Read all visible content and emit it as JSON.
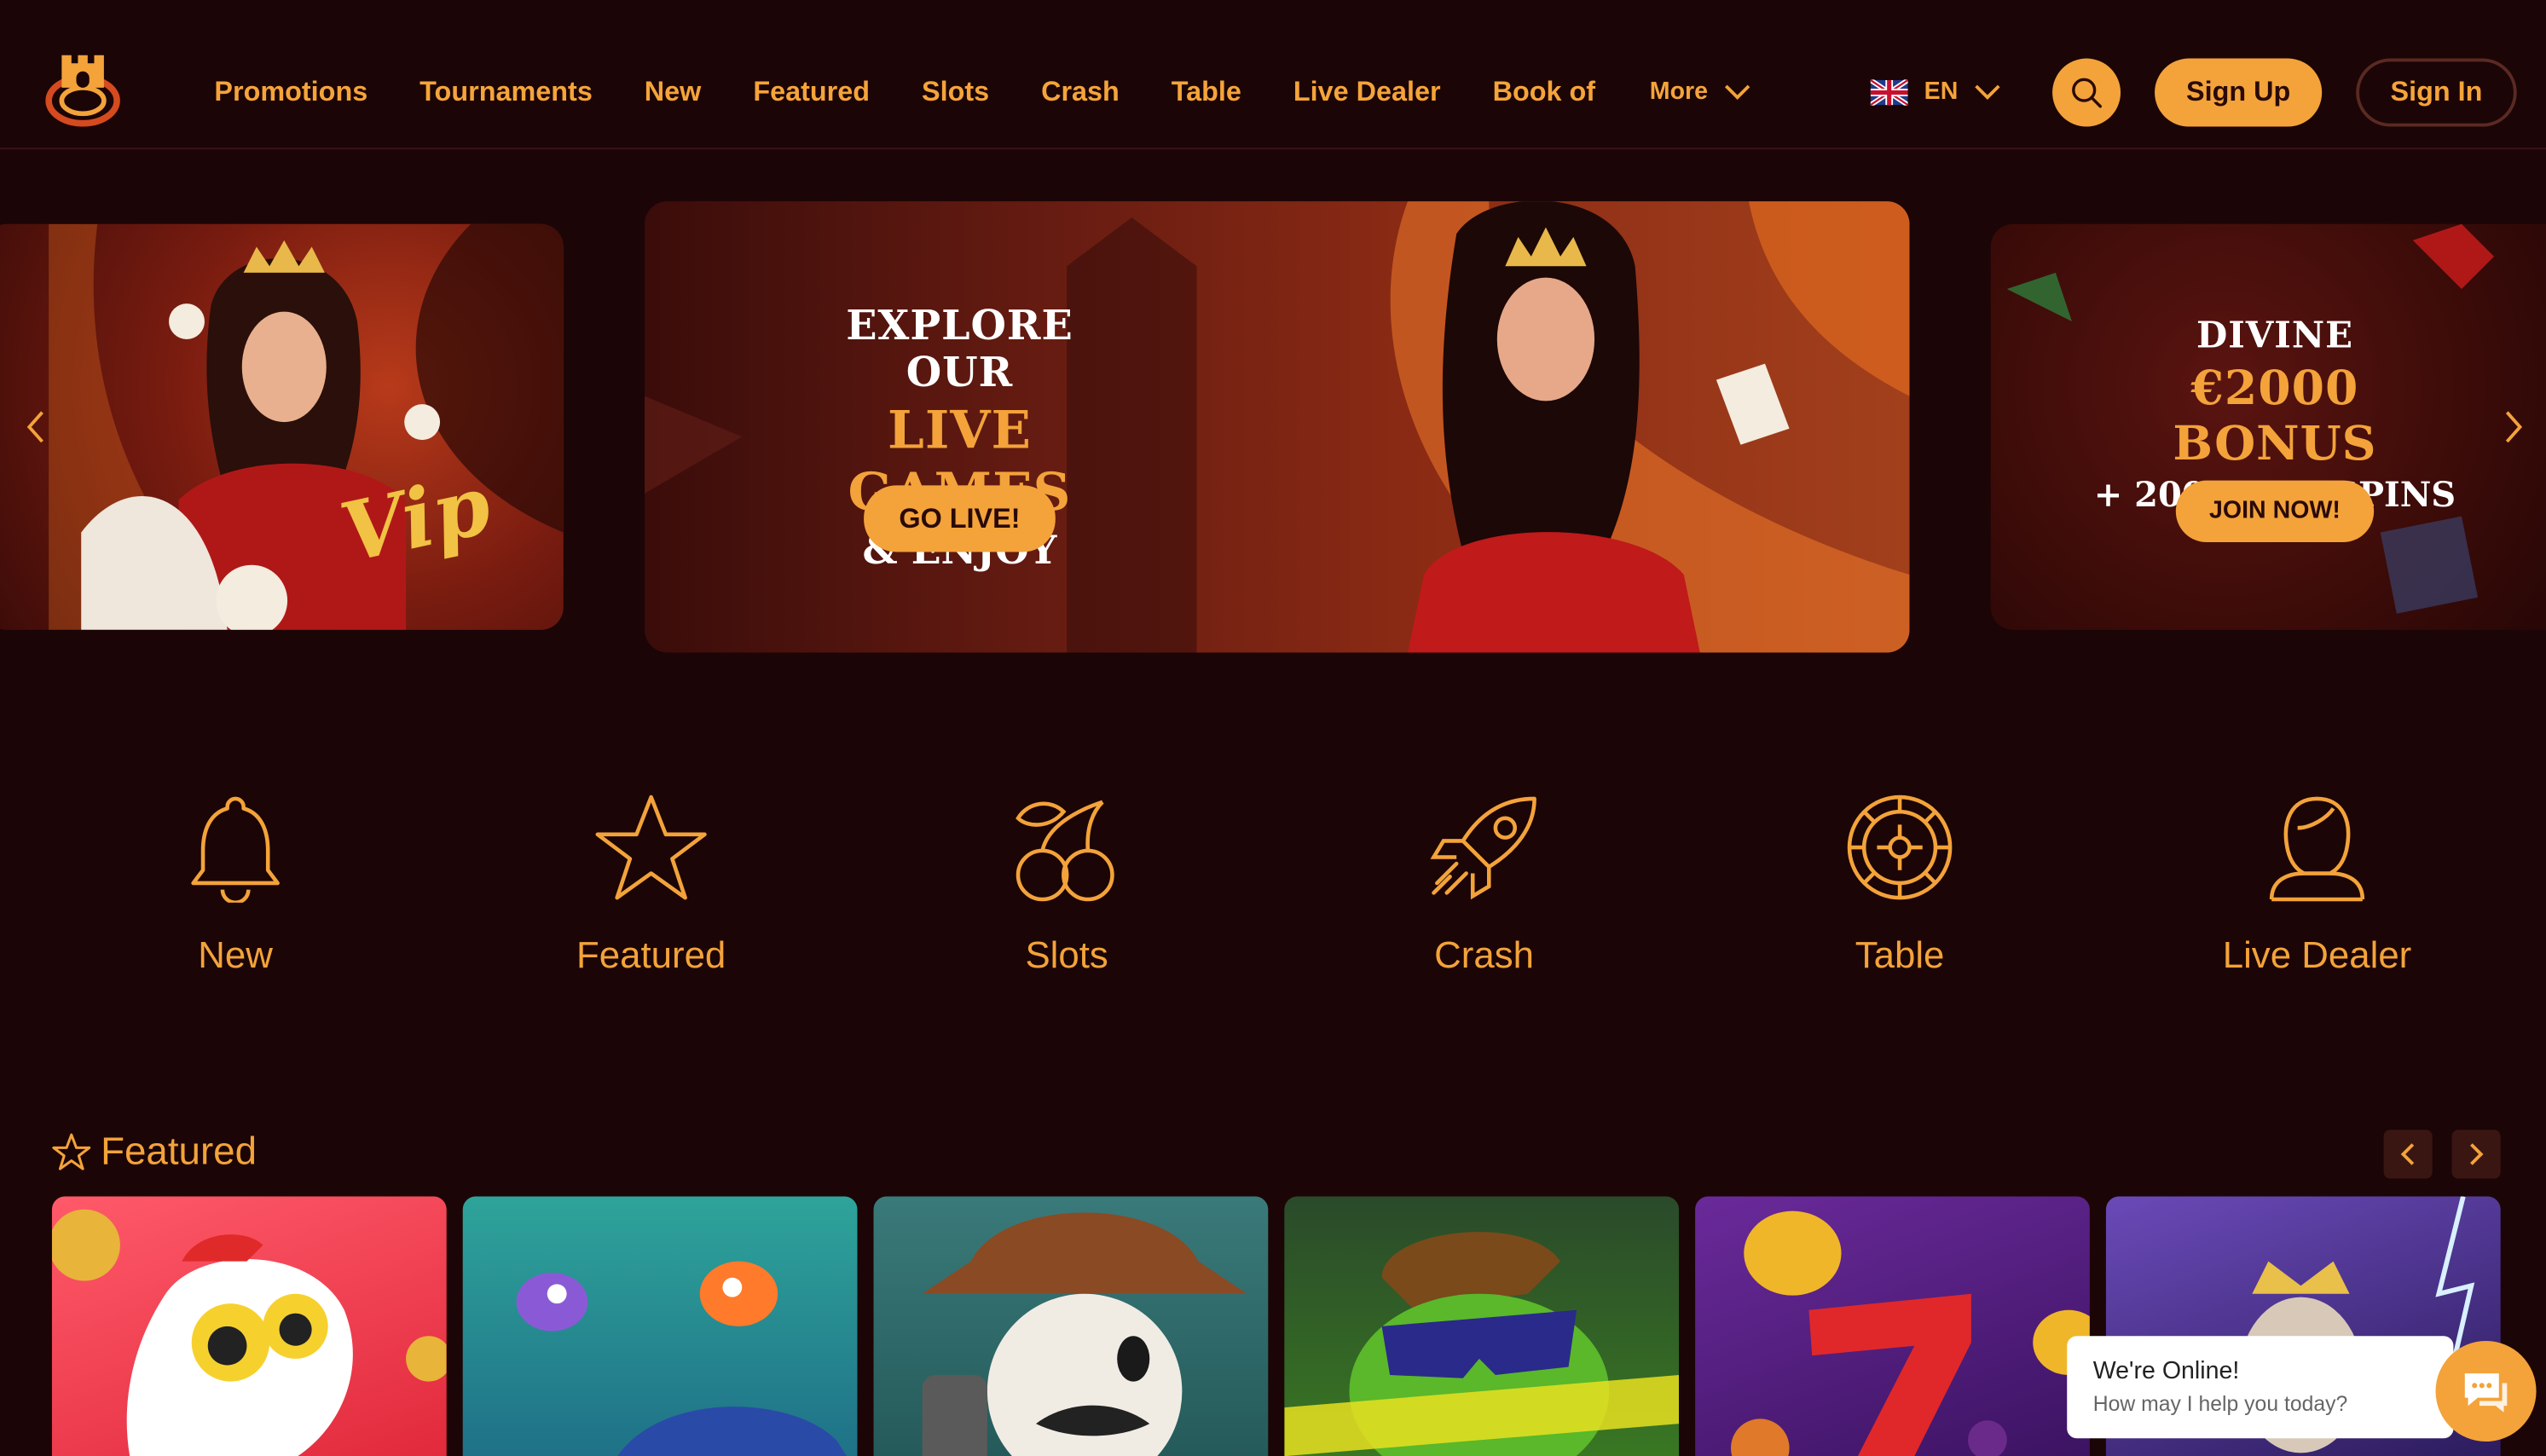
{
  "header": {
    "logo_icon": "castle-logo-icon",
    "nav": [
      "Promotions",
      "Tournaments",
      "New",
      "Featured",
      "Slots",
      "Crash",
      "Table",
      "Live Dealer",
      "Book of"
    ],
    "more_label": "More",
    "language": "EN",
    "flag_icon": "uk-flag-icon",
    "search_icon": "search-icon",
    "signup_label": "Sign Up",
    "signin_label": "Sign In"
  },
  "banners": {
    "center": {
      "line1": "EXPLORE OUR",
      "line2": "LIVE GAMES",
      "line3": "& ENJOY",
      "cta": "GO LIVE!"
    },
    "right": {
      "line1": "DIVINE",
      "line2": "€2000 BONUS",
      "line3": "+ 200 FREE SPINS",
      "cta": "JOIN NOW!"
    },
    "left": {
      "graphic_text": "Vip"
    }
  },
  "categories": [
    {
      "label": "New",
      "icon": "bell-icon"
    },
    {
      "label": "Featured",
      "icon": "star-icon"
    },
    {
      "label": "Slots",
      "icon": "cherries-icon"
    },
    {
      "label": "Crash",
      "icon": "rocket-icon"
    },
    {
      "label": "Table",
      "icon": "roulette-icon"
    },
    {
      "label": "Live Dealer",
      "icon": "dealer-icon"
    }
  ],
  "featured": {
    "title": "Featured",
    "icon": "star-outline-icon"
  },
  "chat": {
    "title": "We're Online!",
    "subtitle": "How may I help you today?",
    "icon": "chat-icon"
  },
  "colors": {
    "background": "#1c0506",
    "accent": "#f3a33a",
    "header_border": "#3b1416"
  }
}
